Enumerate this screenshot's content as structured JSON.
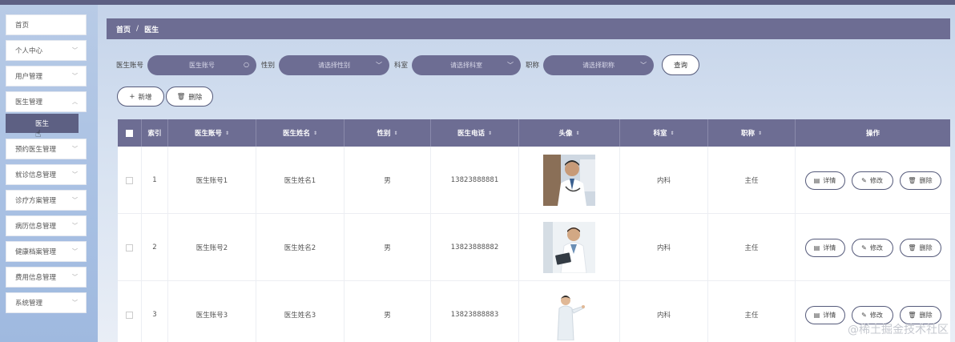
{
  "sidebar": {
    "items": [
      {
        "label": "首页",
        "has_chevron": false
      },
      {
        "label": "个人中心",
        "has_chevron": true
      },
      {
        "label": "用户管理",
        "has_chevron": true
      },
      {
        "label": "医生管理",
        "has_chevron": true
      },
      {
        "label": "预约医生管理",
        "has_chevron": true
      },
      {
        "label": "就诊信息管理",
        "has_chevron": true
      },
      {
        "label": "诊疗方案管理",
        "has_chevron": true
      },
      {
        "label": "病历信息管理",
        "has_chevron": true
      },
      {
        "label": "健康档案管理",
        "has_chevron": true
      },
      {
        "label": "费用信息管理",
        "has_chevron": true
      },
      {
        "label": "系统管理",
        "has_chevron": true
      }
    ],
    "active_sub": "医生"
  },
  "breadcrumb": {
    "home": "首页",
    "separator": "/",
    "current": "医生"
  },
  "filters": {
    "account_label": "医生账号",
    "account_placeholder": "医生账号",
    "gender_label": "性别",
    "gender_placeholder": "请选择性别",
    "dept_label": "科室",
    "dept_placeholder": "请选择科室",
    "title_label": "职称",
    "title_placeholder": "请选择职称",
    "query_label": "查询"
  },
  "actions": {
    "add_label": "新增",
    "delete_label": "删除"
  },
  "table": {
    "headers": {
      "index": "索引",
      "account": "医生账号",
      "name": "医生姓名",
      "gender": "性别",
      "phone": "医生电话",
      "avatar": "头像",
      "dept": "科室",
      "title": "职称",
      "ops": "操作"
    },
    "rows": [
      {
        "index": "1",
        "account": "医生账号1",
        "name": "医生姓名1",
        "gender": "男",
        "phone": "13823888881",
        "dept": "内科",
        "title": "主任"
      },
      {
        "index": "2",
        "account": "医生账号2",
        "name": "医生姓名2",
        "gender": "男",
        "phone": "13823888882",
        "dept": "内科",
        "title": "主任"
      },
      {
        "index": "3",
        "account": "医生账号3",
        "name": "医生姓名3",
        "gender": "男",
        "phone": "13823888883",
        "dept": "内科",
        "title": "主任"
      }
    ],
    "row_actions": {
      "detail": "详情",
      "edit": "修改",
      "delete": "删除"
    }
  },
  "watermark": "@稀土掘金技术社区",
  "colors": {
    "accent": "#6d6d93",
    "header_strip": "#5d6083",
    "border": "#555a7a"
  }
}
